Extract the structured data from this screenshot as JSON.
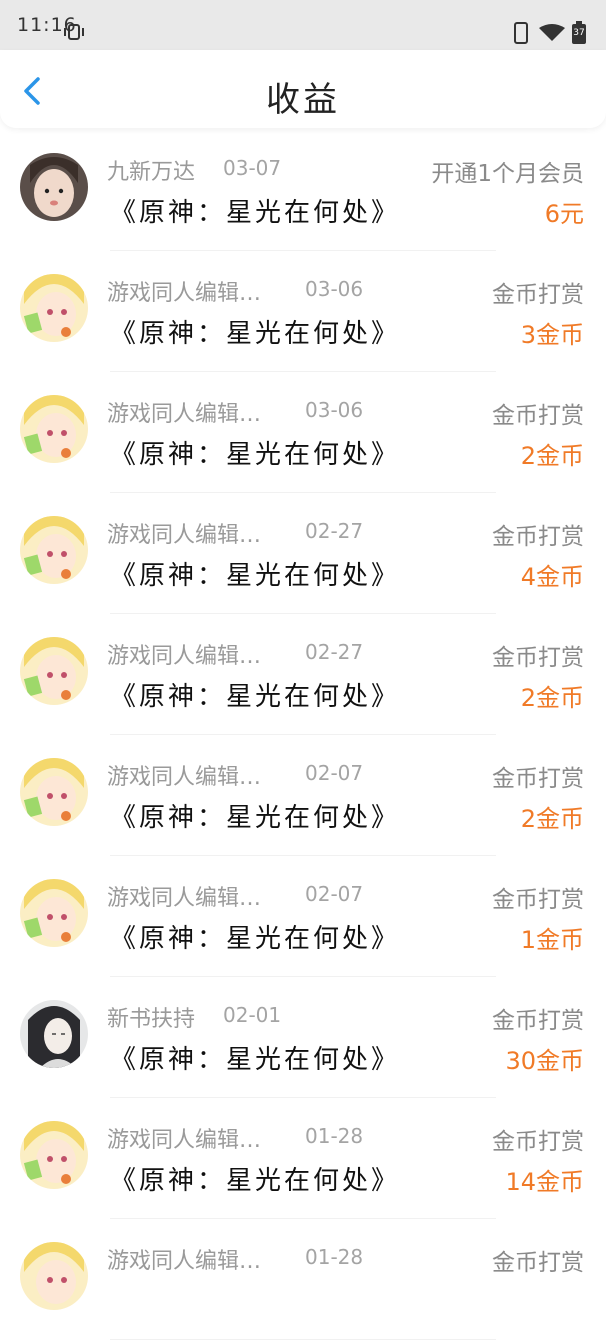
{
  "status_bar": {
    "time": "11:16",
    "battery": "37",
    "icons": [
      "vibrate-icon",
      "phone-icon",
      "wifi-icon",
      "battery-icon"
    ]
  },
  "header": {
    "title": "收益",
    "back_icon": "chevron-left-icon"
  },
  "colors": {
    "accent": "#2b95e8",
    "amount": "#f07a27"
  },
  "records": [
    {
      "author": "九新万达",
      "date": "03-07",
      "type": "开通1个月会员",
      "book": "《原神：星光在何处》",
      "amount": "6元",
      "avatar": "girl-photo"
    },
    {
      "author": "游戏同人编辑…",
      "date": "03-06",
      "type": "金币打赏",
      "book": "《原神：星光在何处》",
      "amount": "3金币",
      "avatar": "anime-girl"
    },
    {
      "author": "游戏同人编辑…",
      "date": "03-06",
      "type": "金币打赏",
      "book": "《原神：星光在何处》",
      "amount": "2金币",
      "avatar": "anime-girl"
    },
    {
      "author": "游戏同人编辑…",
      "date": "02-27",
      "type": "金币打赏",
      "book": "《原神：星光在何处》",
      "amount": "4金币",
      "avatar": "anime-girl"
    },
    {
      "author": "游戏同人编辑…",
      "date": "02-27",
      "type": "金币打赏",
      "book": "《原神：星光在何处》",
      "amount": "2金币",
      "avatar": "anime-girl"
    },
    {
      "author": "游戏同人编辑…",
      "date": "02-07",
      "type": "金币打赏",
      "book": "《原神：星光在何处》",
      "amount": "2金币",
      "avatar": "anime-girl"
    },
    {
      "author": "游戏同人编辑…",
      "date": "02-07",
      "type": "金币打赏",
      "book": "《原神：星光在何处》",
      "amount": "1金币",
      "avatar": "anime-girl"
    },
    {
      "author": "新书扶持",
      "date": "02-01",
      "type": "金币打赏",
      "book": "《原神：星光在何处》",
      "amount": "30金币",
      "avatar": "anime-boy"
    },
    {
      "author": "游戏同人编辑…",
      "date": "01-28",
      "type": "金币打赏",
      "book": "《原神：星光在何处》",
      "amount": "14金币",
      "avatar": "anime-girl"
    },
    {
      "author": "游戏同人编辑…",
      "date": "01-28",
      "type": "金币打赏",
      "book": "",
      "amount": "",
      "avatar": "anime-girl"
    }
  ]
}
